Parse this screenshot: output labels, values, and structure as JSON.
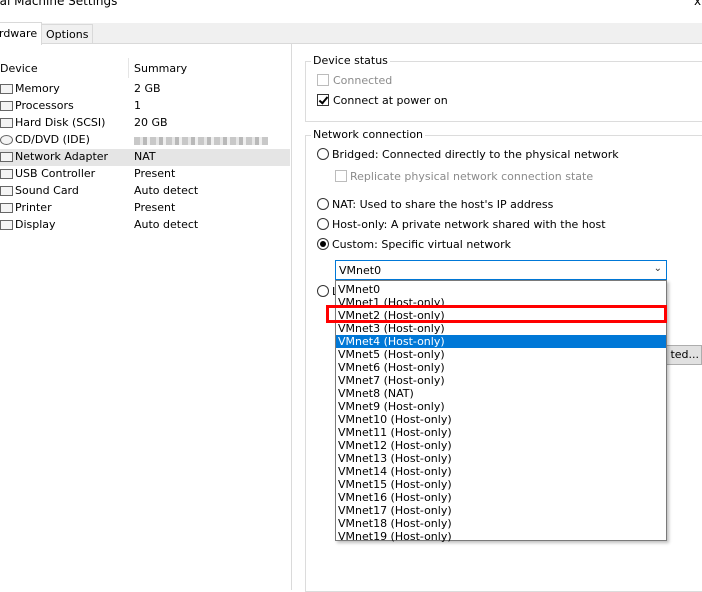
{
  "window": {
    "title": "ual Machine Settings",
    "close_glyph": "x"
  },
  "tabs": [
    {
      "label": "rdware",
      "active": true
    },
    {
      "label": "Options",
      "active": false
    }
  ],
  "device_list": {
    "headers": {
      "device": "Device",
      "summary": "Summary"
    },
    "items": [
      {
        "name": "Memory",
        "summary": "2 GB",
        "icon": "memory-icon"
      },
      {
        "name": "Processors",
        "summary": "1",
        "icon": "processor-icon"
      },
      {
        "name": "Hard Disk (SCSI)",
        "summary": "20 GB",
        "icon": "hard-disk-icon"
      },
      {
        "name": "CD/DVD (IDE)",
        "summary": "",
        "icon": "cd-dvd-icon"
      },
      {
        "name": "Network Adapter",
        "summary": "NAT",
        "icon": "network-adapter-icon",
        "selected": true
      },
      {
        "name": "USB Controller",
        "summary": "Present",
        "icon": "usb-icon"
      },
      {
        "name": "Sound Card",
        "summary": "Auto detect",
        "icon": "sound-card-icon"
      },
      {
        "name": "Printer",
        "summary": "Present",
        "icon": "printer-icon"
      },
      {
        "name": "Display",
        "summary": "Auto detect",
        "icon": "display-icon"
      }
    ]
  },
  "device_status": {
    "title": "Device status",
    "connected": {
      "label": "Connected",
      "checked": false,
      "disabled": true
    },
    "connect_at_power_on": {
      "label": "Connect at power on",
      "checked": true
    }
  },
  "network_connection": {
    "title": "Network connection",
    "bridged": {
      "label": "Bridged: Connected directly to the physical network",
      "checked": false
    },
    "replicate": {
      "label": "Replicate physical network connection state",
      "checked": false,
      "disabled": true
    },
    "nat": {
      "label": "NAT: Used to share the host's IP address",
      "checked": false
    },
    "host_only": {
      "label": "Host-only: A private network shared with the host",
      "checked": false
    },
    "custom": {
      "label": "Custom: Specific virtual network",
      "checked": true
    },
    "lan_partial": "L",
    "combo_value": "VMnet0",
    "options": [
      "VMnet0",
      "VMnet1 (Host-only)",
      "VMnet2 (Host-only)",
      "VMnet3 (Host-only)",
      "VMnet4 (Host-only)",
      "VMnet5 (Host-only)",
      "VMnet6 (Host-only)",
      "VMnet7 (Host-only)",
      "VMnet8 (NAT)",
      "VMnet9 (Host-only)",
      "VMnet10 (Host-only)",
      "VMnet11 (Host-only)",
      "VMnet12 (Host-only)",
      "VMnet13 (Host-only)",
      "VMnet14 (Host-only)",
      "VMnet15 (Host-only)",
      "VMnet16 (Host-only)",
      "VMnet17 (Host-only)",
      "VMnet18 (Host-only)",
      "VMnet19 (Host-only)"
    ],
    "highlighted_option": "VMnet4 (Host-only)",
    "annotated_option": "VMnet2 (Host-only)"
  },
  "partial_button": {
    "label": "ted..."
  },
  "colors": {
    "selection": "#0078d7",
    "annotation": "#ff0000",
    "list_selected": "#e5e5e5"
  }
}
